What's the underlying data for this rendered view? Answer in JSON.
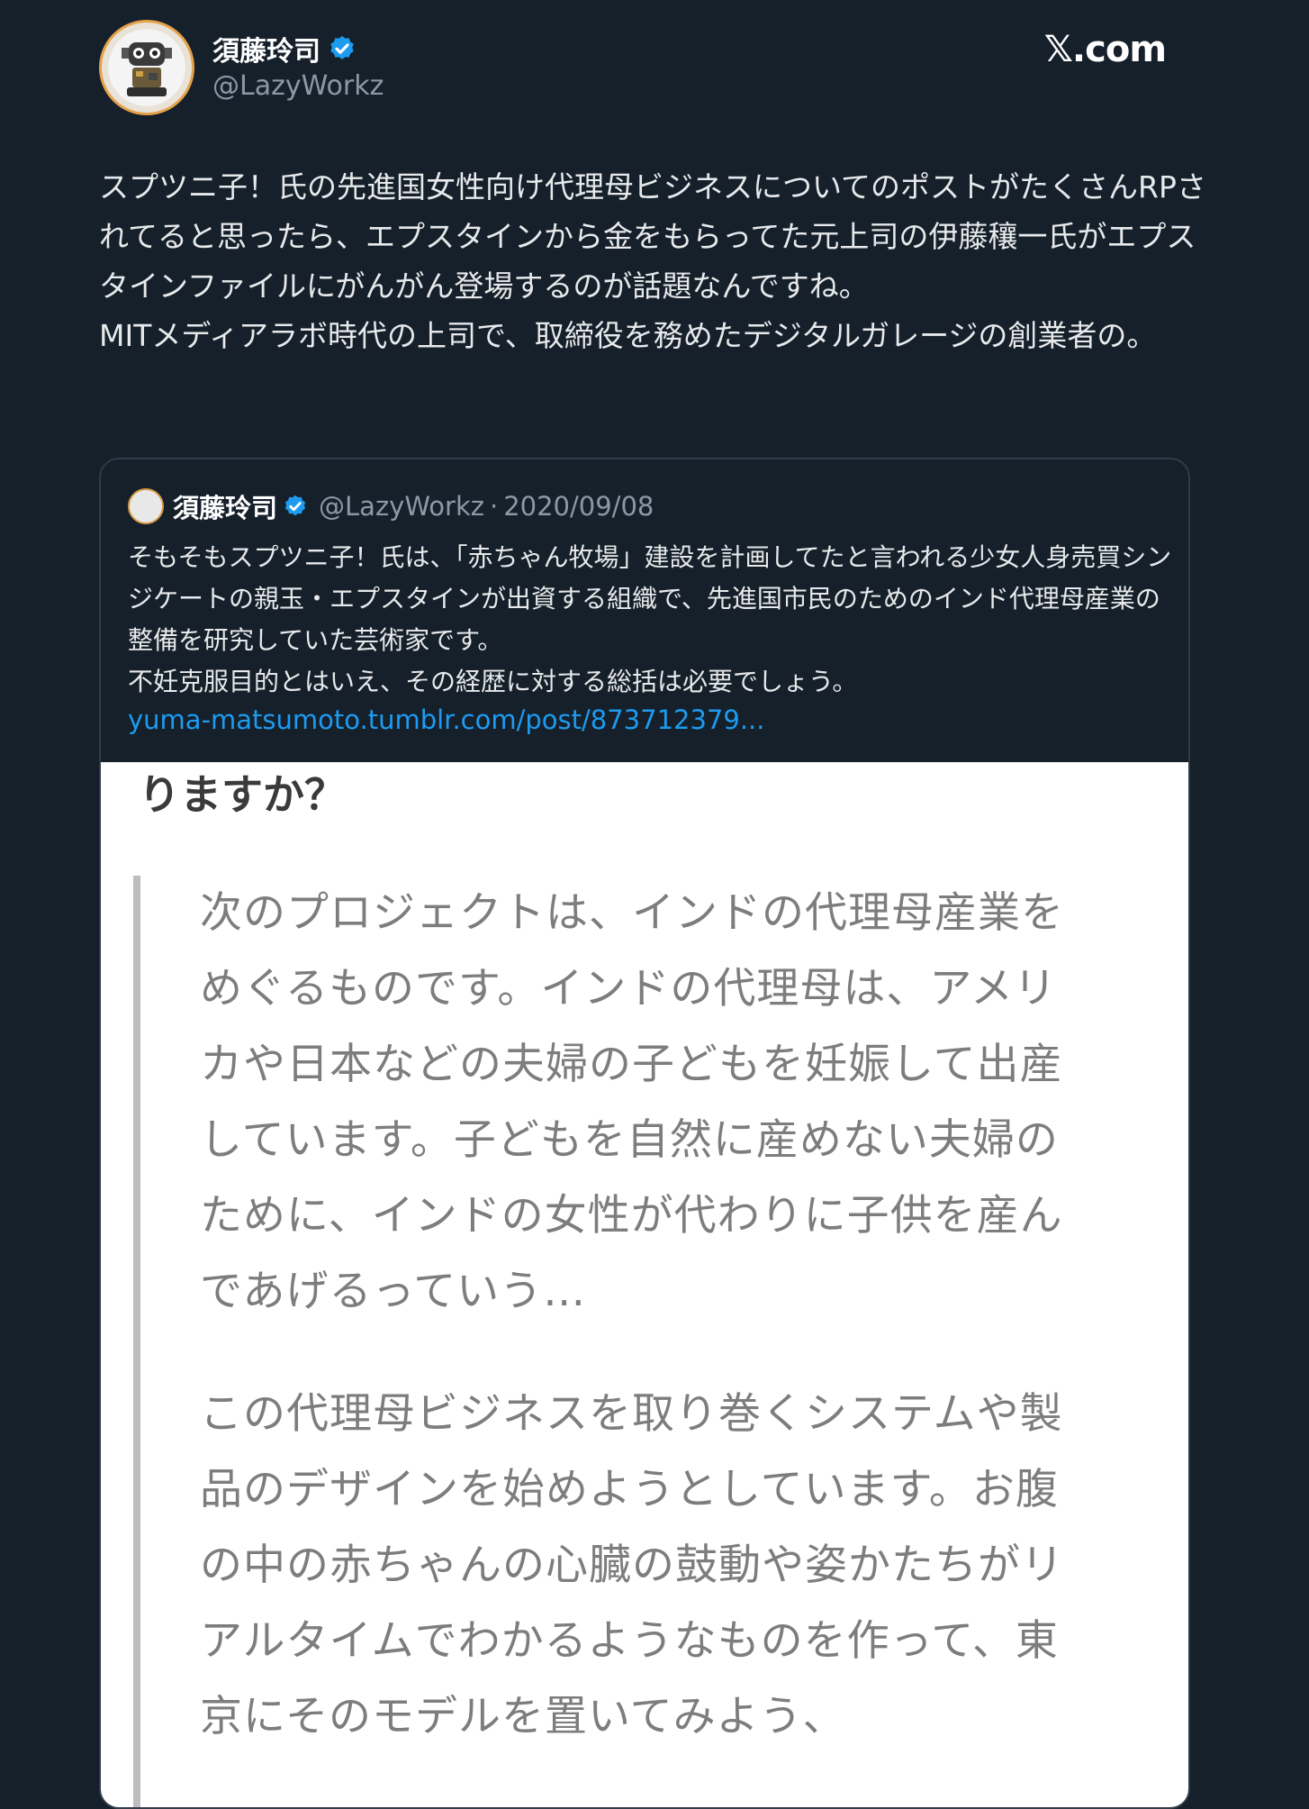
{
  "header": {
    "display_name": "須藤玲司",
    "handle": "@LazyWorkz",
    "site": "𝕏.com",
    "verified_icon": "verified-badge-icon"
  },
  "post": {
    "text": "スプツニ子！氏の先進国女性向け代理母ビジネスについてのポストがたくさんRPされてると思ったら、エプスタインから金をもらってた元上司の伊藤穰一氏がエプスタインファイルにがんがん登場するのが話題なんですね。\nMITメディアラボ時代の上司で、取締役を務めたデジタルガレージの創業者の。"
  },
  "quote": {
    "display_name": "須藤玲司",
    "handle": "@LazyWorkz",
    "separator": "·",
    "date": "2020/09/08",
    "text": "そもそもスプツニ子！氏は、「赤ちゃん牧場」建設を計画してたと言われる少女人身売買シンジケートの親玉・エプスタインが出資する組織で、先進国市民のためのインド代理母産業の整備を研究していた芸術家です。\n不妊克服目的とはいえ、その経歴に対する総括は必要でしょう。",
    "link": "yuma-matsumoto.tumblr.com/post/873712379..."
  },
  "embed": {
    "heading": "りますか？",
    "paragraph1": "次のプロジェクトは、インドの代理母産業をめぐるものです。インドの代理母は、アメリカや日本などの夫婦の子どもを妊娠して出産しています。子どもを自然に産めない夫婦のために、インドの女性が代わりに子供を産んであげるっていう…",
    "paragraph2": "この代理母ビジネスを取り巻くシステムや製品のデザインを始めようとしています。お腹の中の赤ちゃんの心臓の鼓動や姿かたちがリアルタイムでわかるようなものを作って、東京にそのモデルを置いてみよう、"
  },
  "colors": {
    "background": "#15202b",
    "link": "#1d9bf0",
    "verified": "#1d9bf0"
  }
}
